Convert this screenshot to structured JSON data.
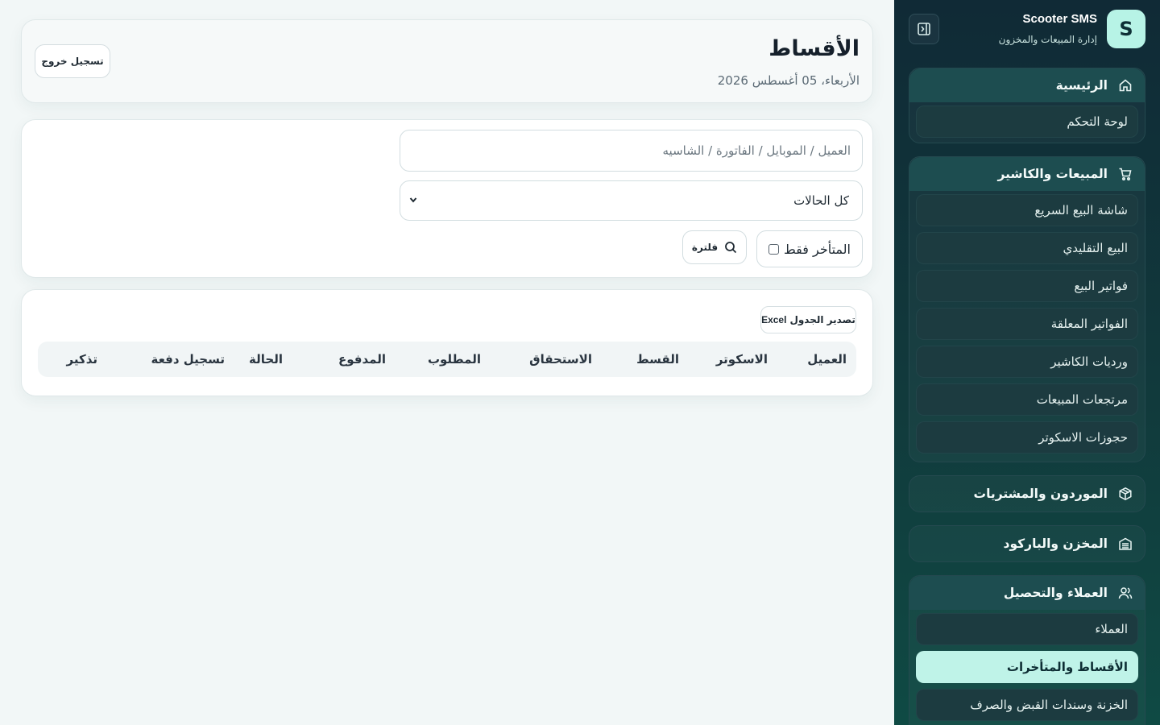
{
  "sidebar": {
    "brand": {
      "logo_letter": "S",
      "name": "Scooter SMS",
      "subtitle": "إدارة المبيعات والمخزون"
    },
    "collapse_icon": "sidebar-collapse-icon",
    "groups": [
      {
        "label": "الرئيسية",
        "icon": "home-icon",
        "items": [
          "لوحة التحكم"
        ]
      },
      {
        "label": "المبيعات والكاشير",
        "icon": "cart-icon",
        "items": [
          "شاشة البيع السريع",
          "البيع التقليدي",
          "فواتير البيع",
          "الفواتير المعلقة",
          "ورديات الكاشير",
          "مرتجعات المبيعات",
          "حجوزات الاسكوتر"
        ]
      },
      {
        "label": "الموردون والمشتريات",
        "icon": "box-icon",
        "items": []
      },
      {
        "label": "المخزن والباركود",
        "icon": "warehouse-icon",
        "items": []
      },
      {
        "label": "العملاء والتحصيل",
        "icon": "users-icon",
        "items": [
          "العملاء",
          "الأقساط والمتأخرات",
          "الخزنة وسندات القبض والصرف"
        ]
      }
    ]
  },
  "header": {
    "title": "الأقساط",
    "date": "الأربعاء، 05 أغسطس 2026",
    "logout_label": "تسجيل خروج"
  },
  "filters": {
    "search_placeholder": "العميل / الموبايل / الفاتورة / الشاسيه",
    "status_selected": "كل الحالات",
    "late_only_label": "المتأخر فقط",
    "filter_button": "فلترة"
  },
  "table": {
    "export_label": "تصدير الجدول",
    "export_brand": "Excel",
    "columns": [
      "العميل",
      "الاسكوتر",
      "القسط",
      "الاستحقاق",
      "المطلوب",
      "المدفوع",
      "الحالة",
      "تسجيل دفعة",
      "تذكير"
    ]
  }
}
